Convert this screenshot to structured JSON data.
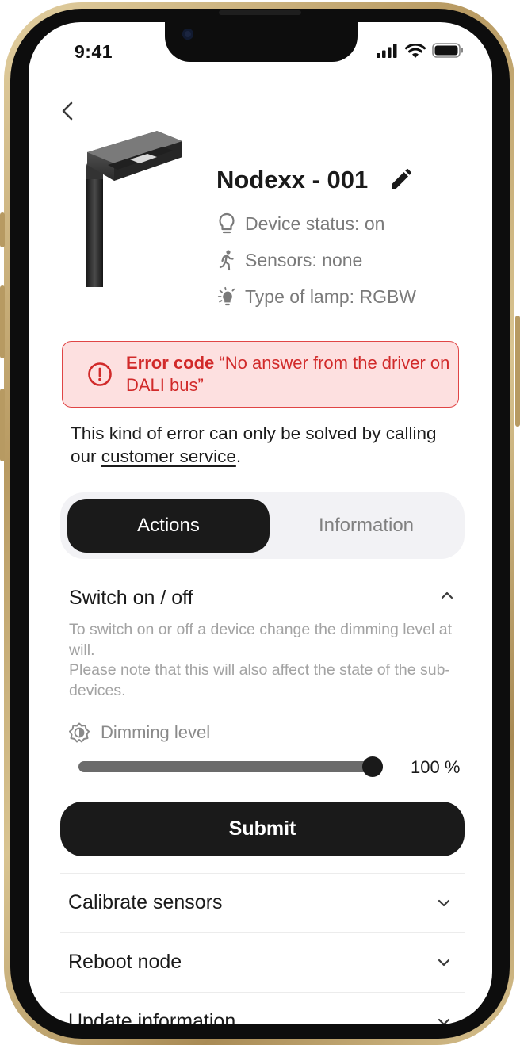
{
  "status_bar": {
    "time": "9:41"
  },
  "device": {
    "name": "Nodexx - 001",
    "status": "Device status: on",
    "sensors": "Sensors: none",
    "lamp_type": "Type of lamp: RGBW"
  },
  "error": {
    "code_label": "Error code",
    "message": "“No answer from the driver on DALI bus”"
  },
  "note": {
    "text_before": "This kind of error can only be solved by calling our ",
    "link": "customer service",
    "text_after": "."
  },
  "tabs": [
    {
      "label": "Actions",
      "active": true
    },
    {
      "label": "Information",
      "active": false
    }
  ],
  "switch_section": {
    "title": "Switch on / off",
    "description_1": "To switch on or off a device change the dimming level at will.",
    "description_2": "Please note that this will also affect the state of the sub-devices.",
    "dimming_label": "Dimming level",
    "dimming_value": 100,
    "dimming_text": "100 %",
    "submit_label": "Submit"
  },
  "accordion": [
    {
      "label": "Calibrate sensors"
    },
    {
      "label": "Reboot node"
    },
    {
      "label": "Update information"
    }
  ],
  "colors": {
    "primary": "#1a1a1a",
    "error_text": "#d12a2a",
    "error_bg": "#fde0e0",
    "muted_text": "#7a7a7a"
  },
  "icons": [
    "chevron-left-icon",
    "edit-pencil-icon",
    "lightbulb-icon",
    "running-person-icon",
    "lamp-type-icon",
    "error-circle-icon",
    "brightness-icon",
    "chevron-up-icon",
    "chevron-down-icon"
  ]
}
